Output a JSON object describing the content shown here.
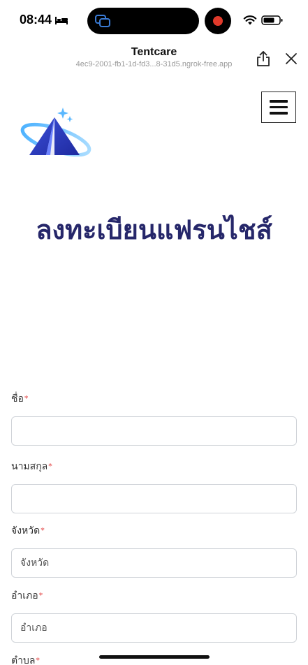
{
  "status_bar": {
    "time": "08:44"
  },
  "browser": {
    "title": "Tentcare",
    "url": "4ec9-2001-fb1-1d-fd3...8-31d5.ngrok-free.app"
  },
  "page": {
    "heading": "ลงทะเบียนแฟรนไชส์"
  },
  "form": {
    "first_name": {
      "label": "ชื่อ",
      "required_mark": "*",
      "value": "",
      "placeholder": ""
    },
    "last_name": {
      "label": "นามสกุล",
      "required_mark": "*",
      "value": "",
      "placeholder": ""
    },
    "province": {
      "label": "จังหวัด",
      "required_mark": "*",
      "value": "",
      "placeholder": "จังหวัด"
    },
    "district": {
      "label": "อำเภอ",
      "required_mark": "*",
      "value": "",
      "placeholder": "อำเภอ"
    },
    "subdistrict": {
      "label": "ตำบล",
      "required_mark": "*"
    }
  },
  "icons": {
    "logo": "tent-logo-icon",
    "menu": "hamburger-menu-icon",
    "share": "share-icon",
    "close": "close-icon"
  },
  "colors": {
    "heading": "#26276a",
    "required": "#e23b3b",
    "input_border": "#cfd3d8"
  }
}
